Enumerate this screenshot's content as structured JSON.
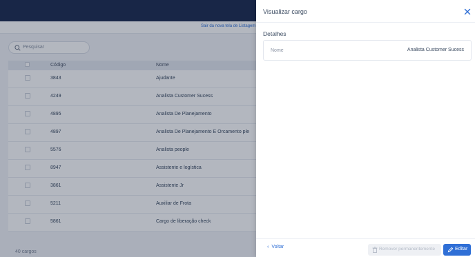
{
  "background": {
    "subbar_link": "Sair da nova tela de Listagem d",
    "search": {
      "placeholder": "Pesquisar"
    },
    "table": {
      "columns": [
        "Código",
        "Nome"
      ],
      "rows": [
        {
          "code": "3843",
          "name": "Ajudante"
        },
        {
          "code": "4249",
          "name": "Analista Customer Sucess"
        },
        {
          "code": "4895",
          "name": "Analista De Planejamento"
        },
        {
          "code": "4897",
          "name": "Analista De Planejamento E Orcamento ple"
        },
        {
          "code": "5576",
          "name": "Analista people"
        },
        {
          "code": "8947",
          "name": "Assistente e logística"
        },
        {
          "code": "3861",
          "name": "Assistente Jr"
        },
        {
          "code": "5211",
          "name": "Auxiliar de Frota"
        },
        {
          "code": "5861",
          "name": "Cargo de liberação check"
        }
      ]
    },
    "count": "40 cargos"
  },
  "drawer": {
    "title": "Visualizar cargo",
    "section_title": "Detalhes",
    "field_label": "Nome",
    "field_value": "Analista Customer Sucess",
    "back_label": "Voltar",
    "remove_label": "Remover permanentemente",
    "edit_label": "Editar"
  },
  "colors": {
    "topbar": "#1b2a4e",
    "accent": "#2f6fd6",
    "disabled_bg": "#eef0f4"
  },
  "icons": {
    "search": "search-icon",
    "close": "close-icon",
    "back": "chevron-left-icon",
    "remove": "trash-icon",
    "edit": "pencil-icon"
  }
}
